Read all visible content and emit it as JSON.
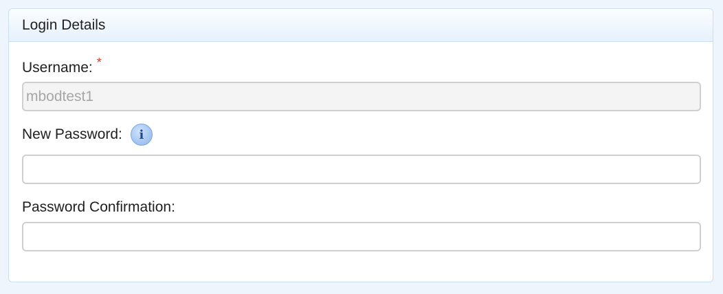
{
  "panel": {
    "title": "Login Details"
  },
  "username": {
    "label": "Username:",
    "required_mark": "*",
    "value": "mbodtest1"
  },
  "new_password": {
    "label": "New Password:",
    "info_icon_glyph": "i",
    "value": ""
  },
  "password_confirmation": {
    "label": "Password Confirmation:",
    "value": ""
  },
  "colors": {
    "page_background": "#eef5fd",
    "panel_border": "#c9dff3",
    "required_star": "#d43a2a",
    "info_icon": "#a9c9f3"
  },
  "icons": {
    "info": "info-icon"
  }
}
